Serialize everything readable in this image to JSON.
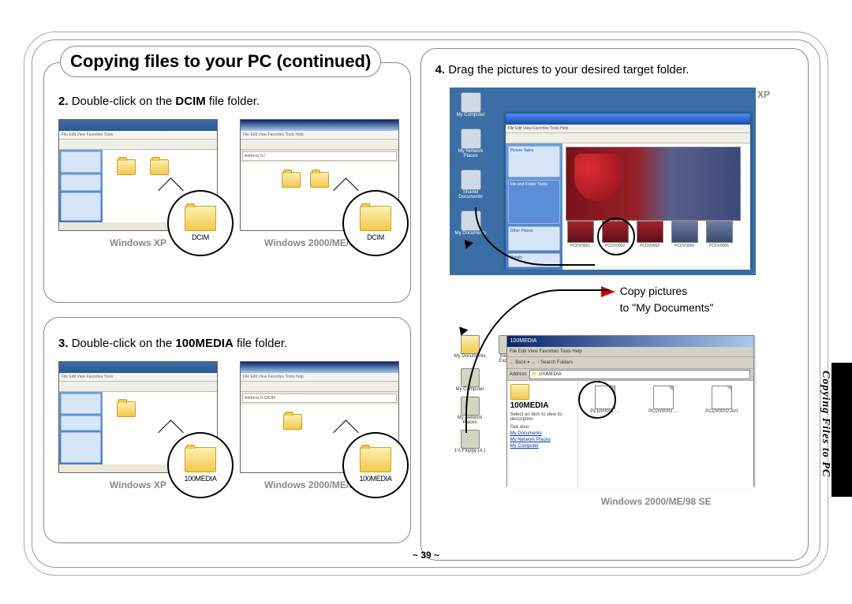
{
  "header": {
    "title": "Copying files to your PC (continued)"
  },
  "step2": {
    "number": "2.",
    "pre_text": "Double-click on the ",
    "bold_word": "DCIM",
    "post_text": " file folder.",
    "callout_label": "DCIM",
    "os_label_left": "Windows XP",
    "os_label_right": "Windows 2000/ME/98 SE"
  },
  "step3": {
    "number": "3.",
    "pre_text": "Double-click on the ",
    "bold_word": "100MEDIA",
    "post_text": " file folder.",
    "callout_label": "100MEDIA",
    "os_label_left": "Windows XP",
    "os_label_right": "Windows 2000/ME/98 SE"
  },
  "step4": {
    "number": "4.",
    "text": "Drag the pictures to your desired target folder.",
    "os_label_xp": "Windows XP",
    "os_label_2k": "Windows 2000/ME/98 SE",
    "copy_line1": "Copy pictures",
    "copy_line2": "to \"My Documents\"",
    "xp_desktop_icons": [
      "My Computer",
      "My Network Places",
      "Shared Documents",
      "My Documents"
    ],
    "w2k_desktop_icons": [
      "My Documents",
      "Internet Explorer",
      "My Computer",
      "My Network Places",
      "1½ Floppy (A:)"
    ],
    "w2k_window": {
      "title": "100MEDIA",
      "menu": "File  Edit  View  Favorites  Tools  Help",
      "toolbar": "← Back  ▾   →   ↑   Search   Folders",
      "address_label": "Address",
      "address_value": "100MEDIA",
      "side_title": "100MEDIA",
      "side_desc": "Select an item to view its description.",
      "side_seealso": "See also:",
      "side_links": [
        "My Documents",
        "My Network Places",
        "My Computer"
      ],
      "files": [
        "PCDV0001 ...",
        "PCDV0003 ...",
        "PCDV0002.AVI"
      ]
    }
  },
  "side_tab": "Copying Files to PC",
  "page_number": "~ 39 ~"
}
